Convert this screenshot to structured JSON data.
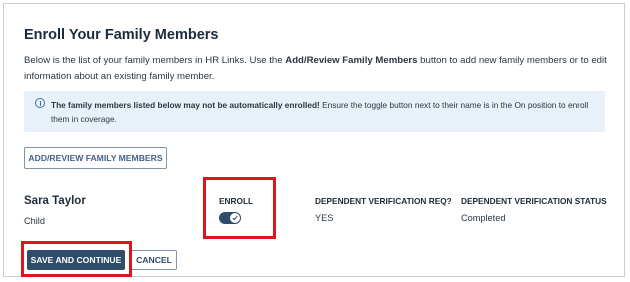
{
  "page": {
    "title": "Enroll Your Family Members",
    "intro": {
      "part1": "Below is the list of your family members in HR Links. Use the ",
      "bold": "Add/Review Family Members",
      "part2": " button to add new family members or to edit information about an existing family member."
    }
  },
  "notice": {
    "icon": "info-icon",
    "bold": "The family members listed below may not be automatically enrolled!",
    "text": " Ensure the toggle button next to their name is in the On position to enroll them in coverage."
  },
  "buttons": {
    "add_review": "ADD/REVIEW FAMILY MEMBERS",
    "save_continue": "SAVE AND CONTINUE",
    "cancel": "CANCEL"
  },
  "columns": {
    "enroll": "ENROLL",
    "verification_req": "DEPENDENT VERIFICATION REQ?",
    "verification_status": "DEPENDENT VERIFICATION STATUS"
  },
  "member": {
    "name": "Sara Taylor",
    "relationship": "Child",
    "enroll_toggle": "on",
    "verification_req": "YES",
    "verification_status": "Completed"
  },
  "colors": {
    "primary": "#2f4c69",
    "notice_bg": "#e8f1fa",
    "highlight": "#e0141c"
  }
}
